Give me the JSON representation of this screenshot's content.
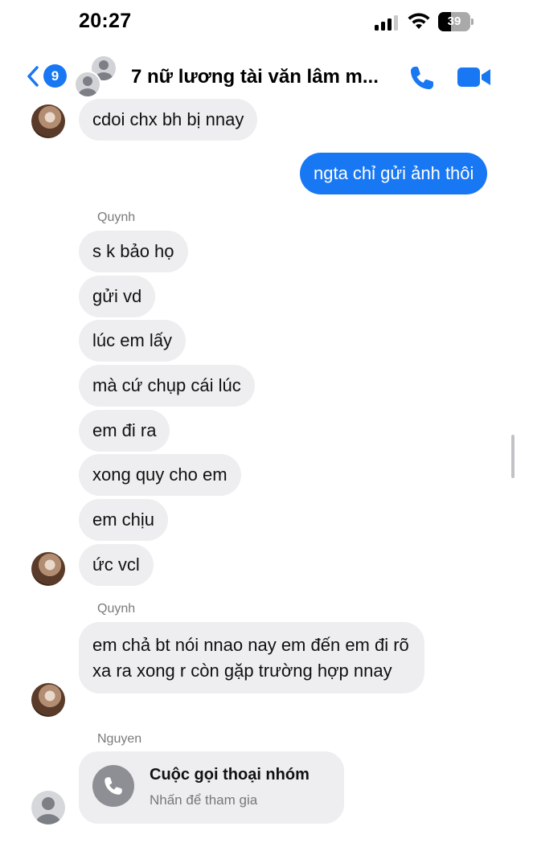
{
  "status_bar": {
    "time": "20:27",
    "battery_level": "39",
    "battery_fraction": 0.39
  },
  "header": {
    "back_badge": "9",
    "title": "7 nữ lương tài văn lâm m...",
    "accent_color": "#1877f2"
  },
  "messages": [
    {
      "sender": "",
      "text": "cdoi chx bh bị nnay",
      "direction": "in"
    },
    {
      "sender": "",
      "text": "ngta chỉ gửi ảnh thôi",
      "direction": "out"
    },
    {
      "sender": "Quynh",
      "text": "s k bảo họ",
      "direction": "in"
    },
    {
      "sender": "",
      "text": "gửi vd",
      "direction": "in"
    },
    {
      "sender": "",
      "text": "lúc em lấy",
      "direction": "in"
    },
    {
      "sender": "",
      "text": "mà cứ chụp cái lúc",
      "direction": "in"
    },
    {
      "sender": "",
      "text": "em đi ra",
      "direction": "in"
    },
    {
      "sender": "",
      "text": "xong quy cho em",
      "direction": "in"
    },
    {
      "sender": "",
      "text": "em chịu",
      "direction": "in"
    },
    {
      "sender": "",
      "text": "ức vcl",
      "direction": "in"
    },
    {
      "sender": "Quynh",
      "text": "em chả bt nói nnao nay em đến em đi rõ xa ra xong r còn gặp trường hợp nnay",
      "direction": "in"
    }
  ],
  "senders": {
    "quynh_1": "Quynh",
    "quynh_2": "Quynh",
    "nguyen": "Nguyen"
  },
  "group_call": {
    "title": "Cuộc gọi thoại nhóm",
    "subtitle": "Nhấn để tham gia"
  },
  "icons": {
    "back": "chevron-left-icon",
    "call": "phone-icon",
    "video": "video-camera-icon",
    "signal": "signal-bars-icon",
    "wifi": "wifi-icon",
    "battery": "battery-icon"
  }
}
